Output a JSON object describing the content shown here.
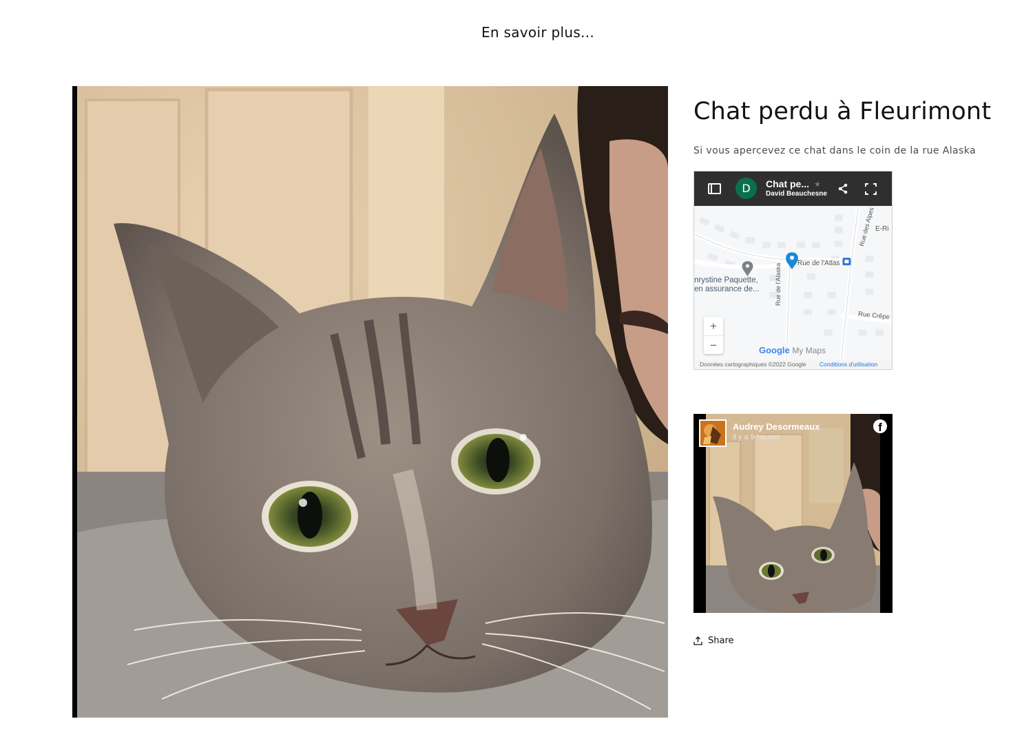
{
  "header": {
    "link_text": "En savoir plus..."
  },
  "product": {
    "title": "Chat perdu à Fleurimont",
    "description": "Si vous apercevez ce chat dans le coin de la rue Alaska",
    "share_label": "Share"
  },
  "map_embed": {
    "avatar_letter": "D",
    "title": "Chat pe...",
    "author": "David Beauchesne",
    "icons": [
      "panel-icon",
      "star-icon",
      "share-icon",
      "fullscreen-icon"
    ],
    "labels": {
      "rue_atlas": "Rue de l'Atlas",
      "rue_alaska": "Rue de l'Alaska",
      "rue_alpes": "Rue des Alpes",
      "rue_crepe": "Rue Crêpe",
      "e_ri": "E-Ri",
      "place_line1": "nrystine Paquette,",
      "place_line2": "en assurance de..."
    },
    "zoom_in": "+",
    "zoom_out": "−",
    "logo_google": "Google",
    "logo_mymaps": "My Maps",
    "footer_data": "Données cartographiques ©2022 Google",
    "footer_terms": "Conditions d'utilisation",
    "colors": {
      "bar": "#2f2f2f",
      "avatar": "#0b6f4f",
      "pin": "#1a8ad4"
    }
  },
  "facebook_embed": {
    "author": "Audrey Desormeaux",
    "time": "il y a 9 heures",
    "logo": "f"
  }
}
